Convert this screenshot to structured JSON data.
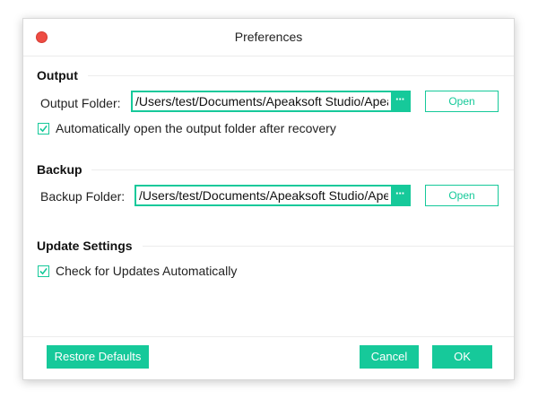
{
  "window": {
    "title": "Preferences"
  },
  "output": {
    "heading": "Output",
    "folder_label": "Output Folder:",
    "folder_path": "/Users/test/Documents/Apeaksoft Studio/Apeaksoft Data Recovery",
    "browse_label": "···",
    "open_label": "Open",
    "auto_open_label": "Automatically open the output folder after recovery",
    "auto_open_checked": true
  },
  "backup": {
    "heading": "Backup",
    "folder_label": "Backup Folder:",
    "folder_path": "/Users/test/Documents/Apeaksoft Studio/Apeaksoft Data Recovery",
    "browse_label": "···",
    "open_label": "Open"
  },
  "update": {
    "heading": "Update Settings",
    "check_label": "Check for Updates Automatically",
    "check_checked": true
  },
  "footer": {
    "restore_label": "Restore Defaults",
    "cancel_label": "Cancel",
    "ok_label": "OK"
  },
  "colors": {
    "accent": "#16c99a",
    "close": "#ee4c43"
  }
}
